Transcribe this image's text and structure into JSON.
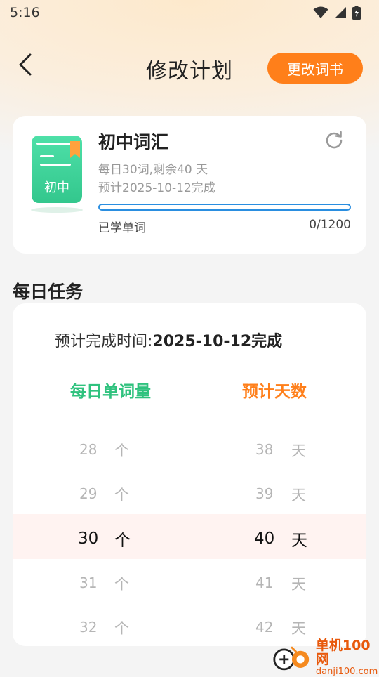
{
  "status": {
    "time": "5:16"
  },
  "header": {
    "title": "修改计划",
    "change_book_label": "更改词书"
  },
  "book": {
    "cover_label": "初中",
    "title": "初中词汇",
    "daily_info": "每日30词,剩余40 天",
    "estimate_info": "预计2025-10-12完成",
    "progress": 0,
    "learned_label": "已学单词",
    "learned_count": "0/1200"
  },
  "daily_task": {
    "section_title": "每日任务",
    "finish_label": "预计完成时间:",
    "finish_date": "2025-10-12完成",
    "words_title": "每日单词量",
    "days_title": "预计天数",
    "word_unit": "个",
    "day_unit": "天",
    "word_options": [
      "28",
      "29",
      "30",
      "31",
      "32"
    ],
    "day_options": [
      "38",
      "39",
      "40",
      "41",
      "42"
    ],
    "selected_words": "30",
    "selected_days": "40"
  },
  "watermark": {
    "main": "单机100网",
    "sub": "danji100.com"
  },
  "colors": {
    "accent_orange": "#ff7f1a",
    "accent_green": "#2fc27e",
    "progress_blue": "#2a8ee0"
  }
}
